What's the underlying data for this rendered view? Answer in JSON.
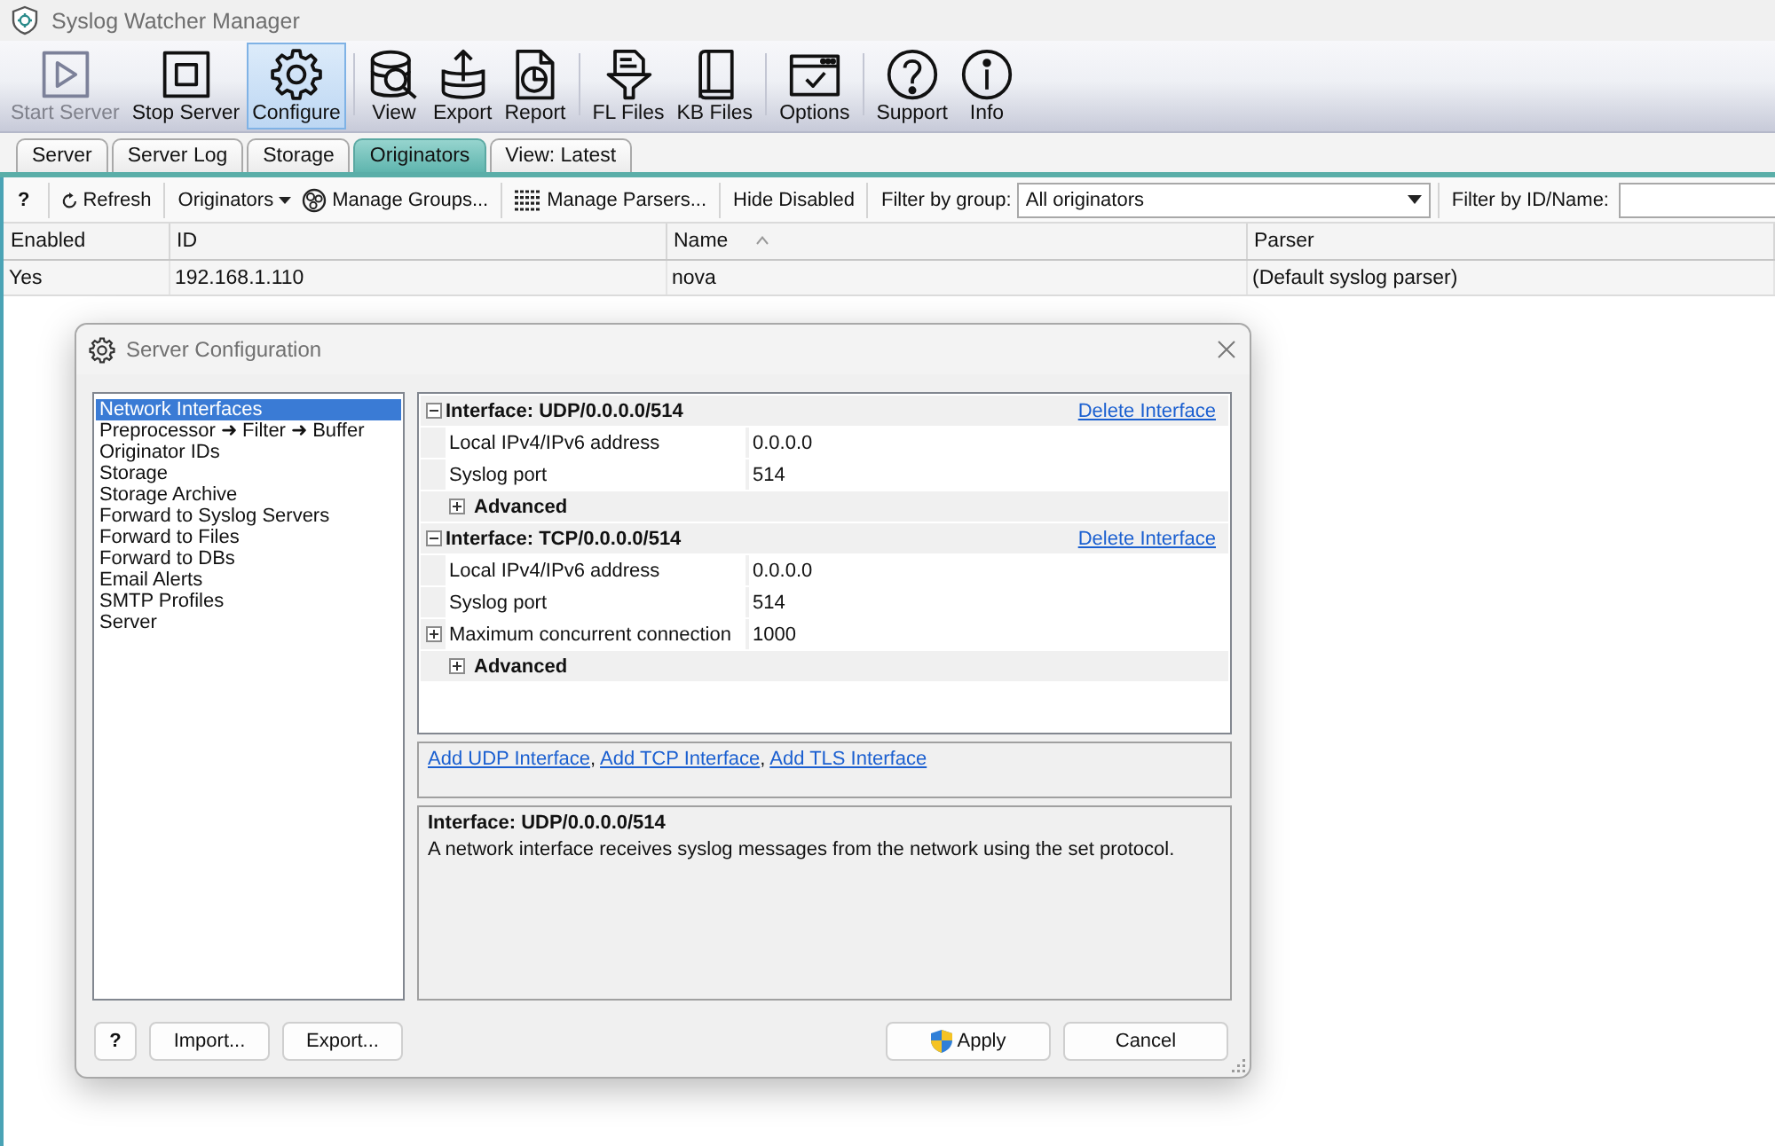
{
  "window": {
    "title": "Syslog Watcher Manager"
  },
  "toolbar": {
    "groups": [
      [
        {
          "label": "Start Server",
          "disabled": true,
          "selected": false
        },
        {
          "label": "Stop Server",
          "disabled": false,
          "selected": false
        },
        {
          "label": "Configure",
          "disabled": false,
          "selected": true
        }
      ],
      [
        {
          "label": "View",
          "disabled": false,
          "selected": false
        },
        {
          "label": "Export",
          "disabled": false,
          "selected": false
        },
        {
          "label": "Report",
          "disabled": false,
          "selected": false
        }
      ],
      [
        {
          "label": "FL Files",
          "disabled": false,
          "selected": false
        },
        {
          "label": "KB Files",
          "disabled": false,
          "selected": false
        }
      ],
      [
        {
          "label": "Options",
          "disabled": false,
          "selected": false
        }
      ],
      [
        {
          "label": "Support",
          "disabled": false,
          "selected": false
        },
        {
          "label": "Info",
          "disabled": false,
          "selected": false
        }
      ]
    ]
  },
  "tabs": [
    {
      "label": "Server",
      "selected": false
    },
    {
      "label": "Server Log",
      "selected": false
    },
    {
      "label": "Storage",
      "selected": false
    },
    {
      "label": "Originators",
      "selected": true
    },
    {
      "label": "View: Latest",
      "selected": false
    }
  ],
  "filter_bar": {
    "help": "?",
    "refresh": "Refresh",
    "originators_menu": "Originators",
    "manage_groups": "Manage Groups...",
    "manage_parsers": "Manage Parsers...",
    "hide_disabled": "Hide Disabled",
    "group_filter": {
      "label": "Filter by group:",
      "value": "All originators"
    },
    "id_filter": {
      "label": "Filter by ID/Name:"
    }
  },
  "table": {
    "columns": [
      {
        "label": "Enabled",
        "sorted": false
      },
      {
        "label": "ID",
        "sorted": false
      },
      {
        "label": "Name",
        "sorted": true
      },
      {
        "label": "Parser",
        "sorted": false
      }
    ],
    "rows": [
      [
        "Yes",
        "192.168.1.110",
        "nova",
        "(Default syslog parser)"
      ]
    ]
  },
  "dialog": {
    "title": "Server Configuration",
    "nav": [
      {
        "label": "Network Interfaces",
        "selected": true
      },
      {
        "label": "Preprocessor ➜ Filter ➜ Buffer",
        "selected": false
      },
      {
        "label": "Originator IDs",
        "selected": false
      },
      {
        "label": "Storage",
        "selected": false
      },
      {
        "label": "Storage Archive",
        "selected": false
      },
      {
        "label": "Forward to Syslog Servers",
        "selected": false
      },
      {
        "label": "Forward to Files",
        "selected": false
      },
      {
        "label": "Forward to DBs",
        "selected": false
      },
      {
        "label": "Email Alerts",
        "selected": false
      },
      {
        "label": "SMTP Profiles",
        "selected": false
      },
      {
        "label": "Server",
        "selected": false
      }
    ],
    "interfaces": [
      {
        "title": "Interface: UDP/0.0.0.0/514",
        "expanded": true,
        "link": "Delete Interface",
        "properties": [
          {
            "kind": "field",
            "label": "Local IPv4/IPv6 address",
            "value": "0.0.0.0"
          },
          {
            "kind": "field",
            "label": "Syslog port",
            "value": "514"
          },
          {
            "kind": "group",
            "label": "Advanced",
            "expanded": false
          }
        ]
      },
      {
        "title": "Interface: TCP/0.0.0.0/514",
        "expanded": true,
        "link": "Delete Interface",
        "properties": [
          {
            "kind": "field",
            "label": "Local IPv4/IPv6 address",
            "value": "0.0.0.0"
          },
          {
            "kind": "field",
            "label": "Syslog port",
            "value": "514"
          },
          {
            "kind": "expandable",
            "label": "Maximum concurrent connection",
            "value": "1000",
            "expanded": false
          },
          {
            "kind": "group",
            "label": "Advanced",
            "expanded": false
          }
        ]
      }
    ],
    "add_links": {
      "items": [
        "Add UDP Interface",
        "Add TCP Interface",
        "Add TLS Interface"
      ],
      "separator": ","
    },
    "description": {
      "title": "Interface: UDP/0.0.0.0/514",
      "text": "A network interface receives syslog messages from the network using the set protocol."
    },
    "left_buttons": [
      "?",
      "Import...",
      "Export..."
    ],
    "right_buttons": [
      "Apply",
      "Cancel"
    ]
  }
}
